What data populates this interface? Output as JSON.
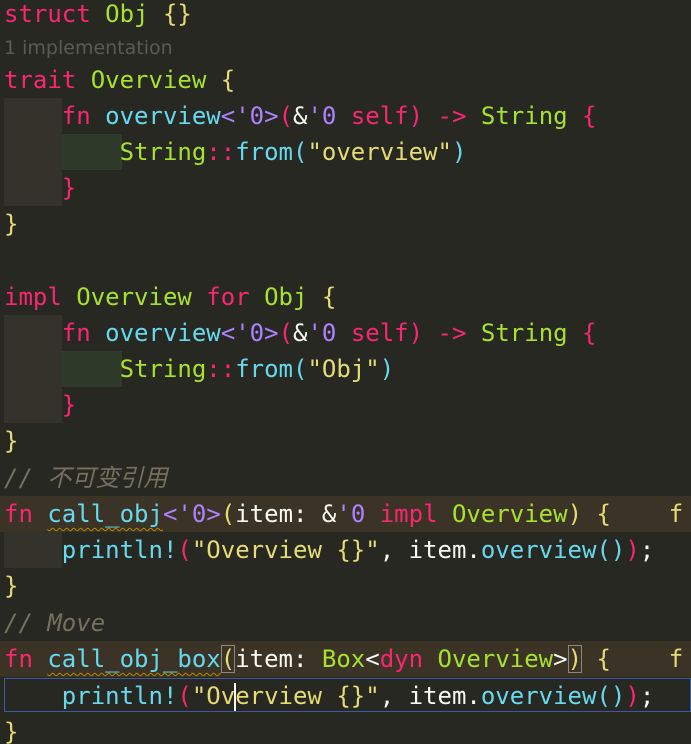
{
  "codelens": "1 implementation",
  "tokens": {
    "struct": "struct",
    "obj": "Obj",
    "trait": "trait",
    "overview_trait": "Overview",
    "fn": "fn",
    "overview_fn": "overview",
    "lt0": "'0",
    "amp": "&",
    "self": "self",
    "arrow": "->",
    "string_type": "String",
    "from": "from",
    "dcolon": "::",
    "str_overview": "\"overview\"",
    "impl": "impl",
    "for": "for",
    "str_obj": "\"Obj\"",
    "comment1": "// 不可变引用",
    "call_obj": "call_obj",
    "item": "item",
    "colon": ":",
    "println": "println!",
    "str_fmt": "\"Overview {}\"",
    "comma": ",",
    "dot": ".",
    "semi": ";",
    "comment2": "// Move",
    "call_obj_box": "call_obj_box",
    "box": "Box",
    "dyn": "dyn",
    "fmt_part1": "\"Ov",
    "fmt_part2": "erview {}\"",
    "trailing_f": "f"
  },
  "colors": {
    "background": "#272822",
    "keyword": "#f92672",
    "type": "#a6e22e",
    "function": "#66d9ef",
    "lifetime": "#ae81ff",
    "string": "#e6db74",
    "comment": "#75715e"
  }
}
